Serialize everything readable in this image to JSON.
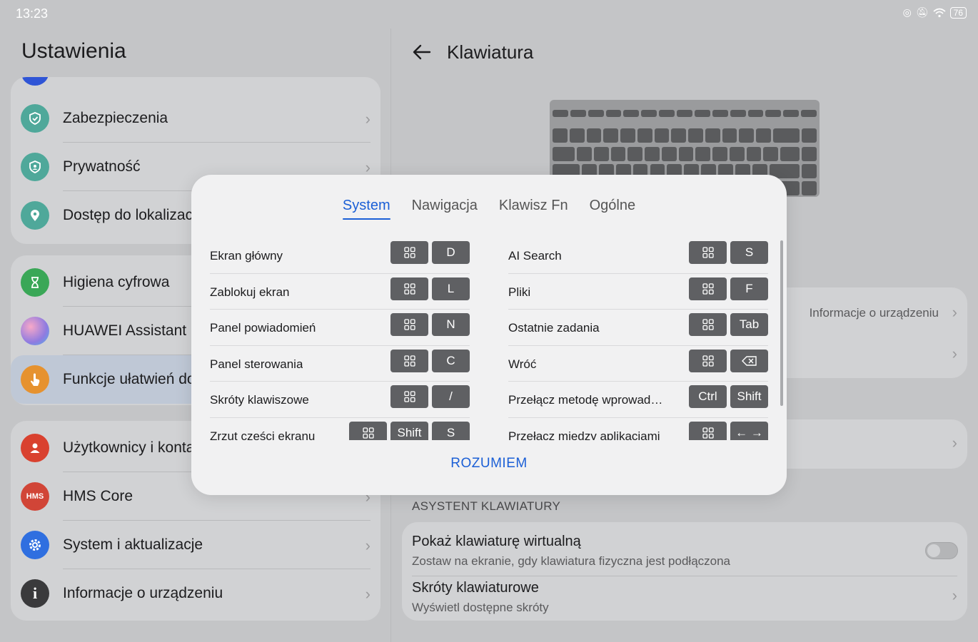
{
  "status": {
    "time": "13:23",
    "battery": "76"
  },
  "left": {
    "title": "Ustawienia",
    "group1": [
      {
        "label": "Zabezpieczenia",
        "icon": "shield-icon",
        "color": "#4fa89a"
      },
      {
        "label": "Prywatność",
        "icon": "privacy-shield-icon",
        "color": "#4fa89a"
      },
      {
        "label": "Dostęp do lokalizacji",
        "icon": "location-pin-icon",
        "color": "#4fa89a"
      }
    ],
    "group2": [
      {
        "label": "Higiena cyfrowa",
        "icon": "hourglass-icon",
        "color": "#3aa757"
      },
      {
        "label": "HUAWEI Assistant",
        "icon": "assistant-orb-icon",
        "color": "#c77bd0"
      },
      {
        "label": "Funkcje ułatwień dostępu",
        "icon": "hand-icon",
        "color": "#e6922f"
      }
    ],
    "group3": [
      {
        "label": "Użytkownicy i konta",
        "icon": "user-icon",
        "color": "#d9412f"
      },
      {
        "label": "HMS Core",
        "icon": "hms-icon",
        "color": "#d14537"
      },
      {
        "label": "System i aktualizacje",
        "icon": "gear-icon",
        "color": "#2f6fe0"
      },
      {
        "label": "Informacje o urządzeniu",
        "icon": "info-icon",
        "color": "#3a3a3c"
      }
    ]
  },
  "right": {
    "title": "Klawiatura",
    "device_info": "Informacje o urządzeniu",
    "section_label": "ASYSTENT KLAWIATURY",
    "virtual_kb_title": "Pokaż klawiaturę wirtualną",
    "virtual_kb_sub": "Zostaw na ekranie, gdy klawiatura fizyczna jest podłączona",
    "shortcuts_title": "Skróty klawiaturowe",
    "shortcuts_sub": "Wyświetl dostępne skróty"
  },
  "dialog": {
    "tabs": [
      "System",
      "Nawigacja",
      "Klawisz Fn",
      "Ogólne"
    ],
    "active_tab": "System",
    "left_items": [
      {
        "name": "Ekran główny",
        "keys": [
          "win",
          "D"
        ]
      },
      {
        "name": "Zablokuj ekran",
        "keys": [
          "win",
          "L"
        ]
      },
      {
        "name": "Panel powiadomień",
        "keys": [
          "win",
          "N"
        ]
      },
      {
        "name": "Panel sterowania",
        "keys": [
          "win",
          "C"
        ]
      },
      {
        "name": "Skróty klawiszowe",
        "keys": [
          "win",
          "/"
        ]
      },
      {
        "name": "Zrzut części ekranu",
        "keys": [
          "win",
          "Shift",
          "S"
        ]
      }
    ],
    "right_items": [
      {
        "name": "AI Search",
        "keys": [
          "win",
          "S"
        ]
      },
      {
        "name": "Pliki",
        "keys": [
          "win",
          "F"
        ]
      },
      {
        "name": "Ostatnie zadania",
        "keys": [
          "win",
          "Tab"
        ]
      },
      {
        "name": "Wróć",
        "keys": [
          "win",
          "backspace"
        ]
      },
      {
        "name": "Przełącz metodę wprowad…",
        "keys": [
          "Ctrl",
          "Shift"
        ]
      },
      {
        "name": "Przełącz między aplikacjami",
        "keys": [
          "win",
          "← →"
        ]
      }
    ],
    "confirm": "ROZUMIEM"
  },
  "colors": {
    "accent": "#1b5fd6",
    "key_bg": "#5f6063"
  }
}
